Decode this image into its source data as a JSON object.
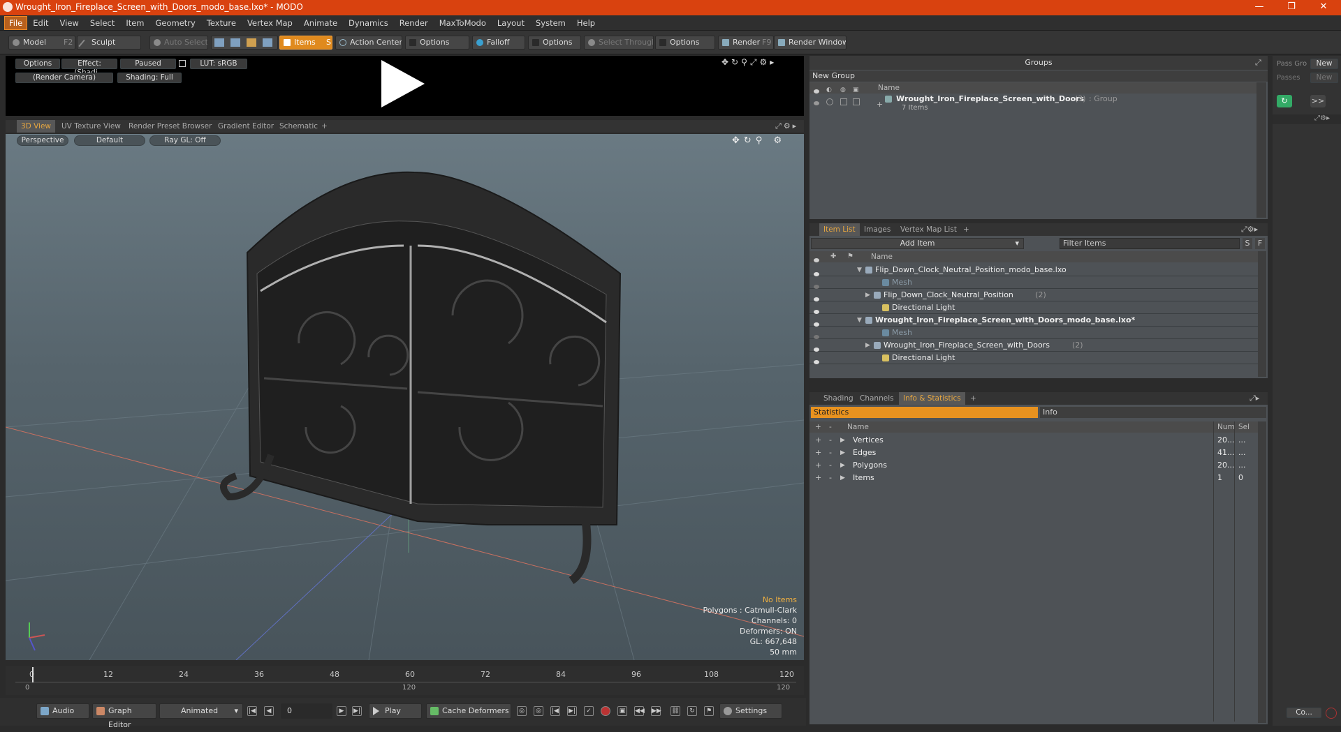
{
  "window": {
    "title": "Wrought_Iron_Fireplace_Screen_with_Doors_modo_base.lxo* - MODO",
    "controls": [
      "—",
      "❐",
      "✕"
    ]
  },
  "menu": [
    "File",
    "Edit",
    "View",
    "Select",
    "Item",
    "Geometry",
    "Texture",
    "Vertex Map",
    "Animate",
    "Dynamics",
    "Render",
    "MaxToModo",
    "Layout",
    "System",
    "Help"
  ],
  "toolbar": {
    "model": "Model",
    "model_key": "F2",
    "sculpt": "Sculpt",
    "auto_select": "Auto Select",
    "items": "Items",
    "items_key": "S",
    "action_center": "Action Center",
    "options1": "Options",
    "falloff": "Falloff",
    "options2": "Options",
    "select_through": "Select Through",
    "options3": "Options",
    "render": "Render",
    "render_key": "F9",
    "render_window": "Render Window"
  },
  "preview": {
    "options": "Options",
    "effect": "Effect: (Shadi...",
    "paused": "Paused",
    "lut": "LUT: sRGB",
    "camera": "(Render Camera)",
    "shading": "Shading: Full"
  },
  "viewtabs": [
    "3D View",
    "UV Texture View",
    "Render Preset Browser",
    "Gradient Editor",
    "Schematic",
    "+"
  ],
  "viewport": {
    "projection": "Perspective",
    "style": "Default",
    "raygl": "Ray GL: Off",
    "hud": {
      "no_items": "No Items",
      "polygons": "Polygons : Catmull-Clark",
      "channels": "Channels: 0",
      "deformers": "Deformers: ON",
      "gl": "GL: 667,648",
      "lens": "50 mm"
    }
  },
  "timeline": {
    "ticks": [
      "0",
      "12",
      "24",
      "36",
      "48",
      "60",
      "72",
      "84",
      "96",
      "108",
      "120"
    ],
    "low": [
      "0",
      "120",
      "120"
    ]
  },
  "bottom": {
    "audio": "Audio",
    "graph": "Graph Editor",
    "animated": "Animated",
    "frame": "0",
    "play": "Play",
    "cache": "Cache Deformers",
    "settings": "Settings"
  },
  "groups": {
    "header": "Groups",
    "new_group": "New Group",
    "col_name": "Name",
    "item": "Wrought_Iron_Fireplace_Screen_with_Doors",
    "item_count": "(3)",
    "item_type": ": Group",
    "item_sub": "7 Items"
  },
  "passes": {
    "pass_label": "Pass Gro",
    "new1": "New",
    "passes_label": "Passes",
    "new2": "New",
    "expand": ">>",
    "co": "Co..."
  },
  "itemlist": {
    "tabs": [
      "Item List",
      "Images",
      "Vertex Map List",
      "+"
    ],
    "add_item": "Add Item",
    "filter": "Filter Items",
    "s": "S",
    "f": "F",
    "col_name": "Name",
    "rows": [
      {
        "name": "Flip_Down_Clock_Neutral_Position_modo_base.lxo",
        "count": "",
        "level": 0,
        "bold": false,
        "dim": false,
        "arrow": "▼"
      },
      {
        "name": "Mesh",
        "count": "",
        "level": 2,
        "bold": false,
        "dim": true,
        "arrow": ""
      },
      {
        "name": "Flip_Down_Clock_Neutral_Position",
        "count": "(2)",
        "level": 1,
        "bold": false,
        "dim": false,
        "arrow": "▶"
      },
      {
        "name": "Directional Light",
        "count": "",
        "level": 2,
        "bold": false,
        "dim": false,
        "arrow": ""
      },
      {
        "name": "Wrought_Iron_Fireplace_Screen_with_Doors_modo_base.lxo*",
        "count": "",
        "level": 0,
        "bold": true,
        "dim": false,
        "arrow": "▼"
      },
      {
        "name": "Mesh",
        "count": "",
        "level": 2,
        "bold": false,
        "dim": true,
        "arrow": ""
      },
      {
        "name": "Wrought_Iron_Fireplace_Screen_with_Doors",
        "count": "(2)",
        "level": 1,
        "bold": false,
        "dim": false,
        "arrow": "▶"
      },
      {
        "name": "Directional Light",
        "count": "",
        "level": 2,
        "bold": false,
        "dim": false,
        "arrow": ""
      }
    ]
  },
  "info": {
    "tabs": [
      "Shading",
      "Channels",
      "Info & Statistics",
      "+"
    ],
    "statistics": "Statistics",
    "info": "Info",
    "col_name": "Name",
    "col_num": "Num",
    "col_sel": "Sel",
    "rows": [
      {
        "name": "Vertices",
        "num": "20...",
        "sel": "..."
      },
      {
        "name": "Edges",
        "num": "41...",
        "sel": "..."
      },
      {
        "name": "Polygons",
        "num": "20...",
        "sel": "..."
      },
      {
        "name": "Items",
        "num": "1",
        "sel": "0"
      }
    ]
  }
}
